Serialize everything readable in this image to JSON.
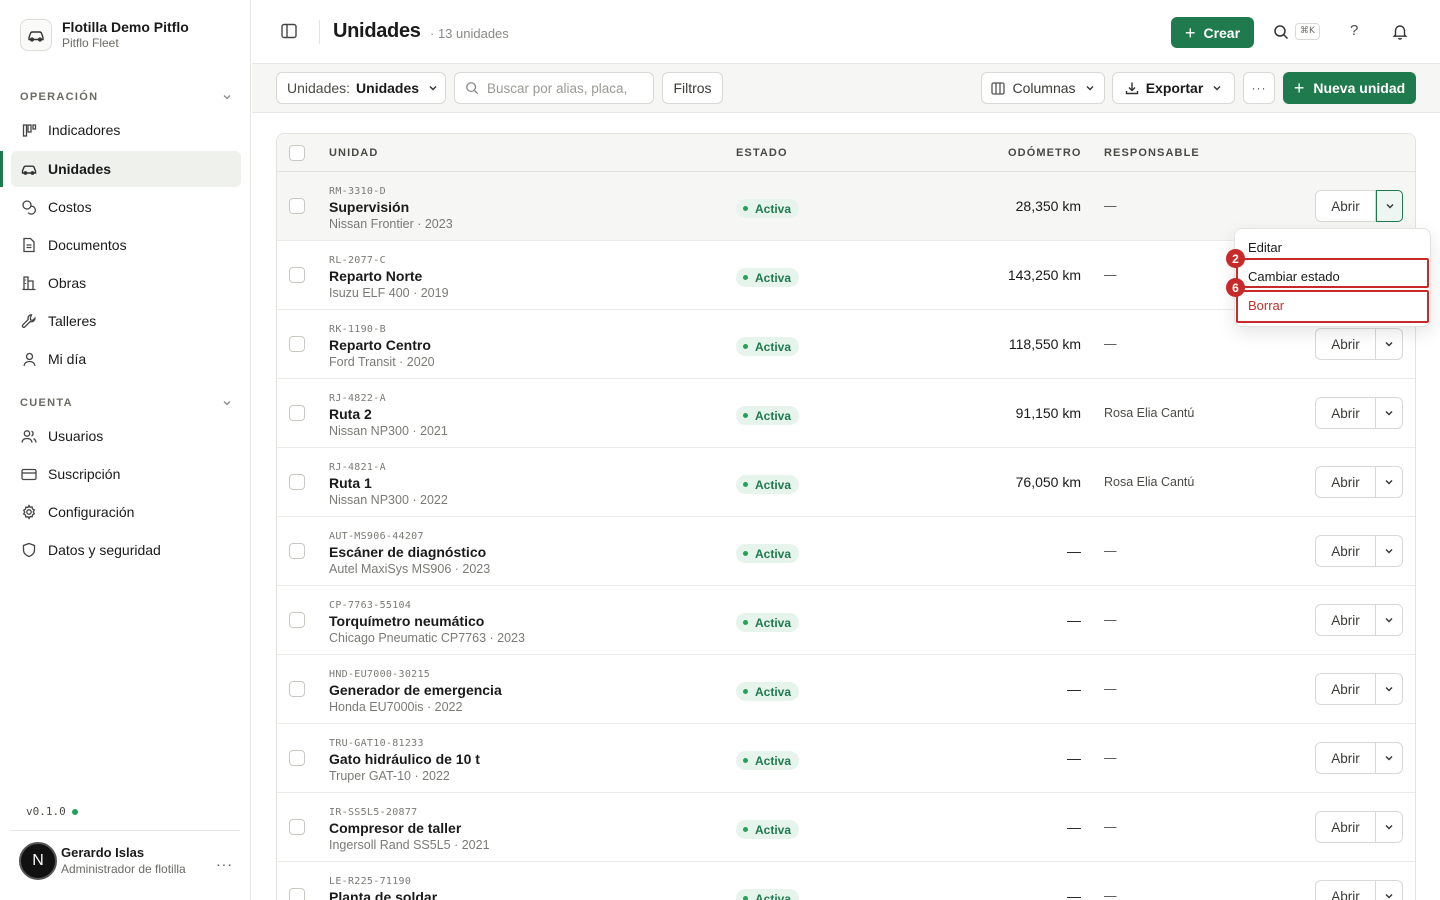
{
  "org": {
    "name": "Flotilla Demo Pitflo",
    "sub": "Pitflo Fleet"
  },
  "sidebar": {
    "sections": [
      {
        "label": "OPERACIÓN"
      },
      {
        "label": "CUENTA"
      }
    ],
    "items": [
      {
        "label": "Indicadores",
        "icon": "chart-bars-icon"
      },
      {
        "label": "Unidades",
        "icon": "car-icon",
        "active": true
      },
      {
        "label": "Costos",
        "icon": "coins-icon"
      },
      {
        "label": "Documentos",
        "icon": "document-icon"
      },
      {
        "label": "Obras",
        "icon": "building-icon"
      },
      {
        "label": "Talleres",
        "icon": "wrench-icon"
      },
      {
        "label": "Mi día",
        "icon": "user-icon"
      },
      {
        "label": "Usuarios",
        "icon": "users-icon"
      },
      {
        "label": "Suscripción",
        "icon": "credit-card-icon"
      },
      {
        "label": "Configuración",
        "icon": "gear-icon"
      },
      {
        "label": "Datos y seguridad",
        "icon": "shield-icon"
      }
    ],
    "version": "v0.1.0"
  },
  "user": {
    "initial": "N",
    "name": "Gerardo Islas",
    "role": "Administrador de flotilla",
    "more": "···"
  },
  "header": {
    "title": "Unidades",
    "count": "· 13 unidades",
    "create_label": "Crear",
    "shortcut": "⌘K",
    "help": "?"
  },
  "toolbar": {
    "select_label": "Unidades:",
    "select_value": "Unidades",
    "search_placeholder": "Buscar por alias, placa,",
    "filters": "Filtros",
    "columns": "Columnas",
    "export": "Exportar",
    "more": "···",
    "new_unit": "Nueva unidad"
  },
  "table": {
    "columns": [
      "UNIDAD",
      "ESTADO",
      "ODÓMETRO",
      "RESPONSABLE"
    ],
    "open_label": "Abrir",
    "rows": [
      {
        "code": "RM-3310-D",
        "name": "Supervisión",
        "model": "Nissan Frontier · 2023",
        "status": "Activa",
        "odometer": "28,350 km",
        "responsible": "—"
      },
      {
        "code": "RL-2077-C",
        "name": "Reparto Norte",
        "model": "Isuzu ELF 400 · 2019",
        "status": "Activa",
        "odometer": "143,250 km",
        "responsible": "—"
      },
      {
        "code": "RK-1190-B",
        "name": "Reparto Centro",
        "model": "Ford Transit · 2020",
        "status": "Activa",
        "odometer": "118,550 km",
        "responsible": "—"
      },
      {
        "code": "RJ-4822-A",
        "name": "Ruta 2",
        "model": "Nissan NP300 · 2021",
        "status": "Activa",
        "odometer": "91,150 km",
        "responsible": "Rosa Elia Cantú"
      },
      {
        "code": "RJ-4821-A",
        "name": "Ruta 1",
        "model": "Nissan NP300 · 2022",
        "status": "Activa",
        "odometer": "76,050 km",
        "responsible": "Rosa Elia Cantú"
      },
      {
        "code": "AUT-MS906-44207",
        "name": "Escáner de diagnóstico",
        "model": "Autel MaxiSys MS906 · 2023",
        "status": "Activa",
        "odometer": "—",
        "responsible": "—"
      },
      {
        "code": "CP-7763-55104",
        "name": "Torquímetro neumático",
        "model": "Chicago Pneumatic CP7763 · 2023",
        "status": "Activa",
        "odometer": "—",
        "responsible": "—"
      },
      {
        "code": "HND-EU7000-30215",
        "name": "Generador de emergencia",
        "model": "Honda EU7000is · 2022",
        "status": "Activa",
        "odometer": "—",
        "responsible": "—"
      },
      {
        "code": "TRU-GAT10-81233",
        "name": "Gato hidráulico de 10 t",
        "model": "Truper GAT-10 · 2022",
        "status": "Activa",
        "odometer": "—",
        "responsible": "—"
      },
      {
        "code": "IR-SS5L5-20877",
        "name": "Compresor de taller",
        "model": "Ingersoll Rand SS5L5 · 2021",
        "status": "Activa",
        "odometer": "—",
        "responsible": "—"
      },
      {
        "code": "LE-R225-71190",
        "name": "Planta de soldar",
        "model": "",
        "status": "Activa",
        "odometer": "—",
        "responsible": "—"
      }
    ]
  },
  "menu": {
    "items": [
      {
        "label": "Editar"
      },
      {
        "label": "Cambiar estado",
        "marker": "2"
      },
      {
        "label": "Borrar",
        "marker": "6",
        "danger": true
      }
    ]
  },
  "colors": {
    "accent": "#1f7a4d",
    "danger": "#c4312a",
    "marker": "#c82a2a",
    "badge_bg": "#e7f4ec"
  }
}
